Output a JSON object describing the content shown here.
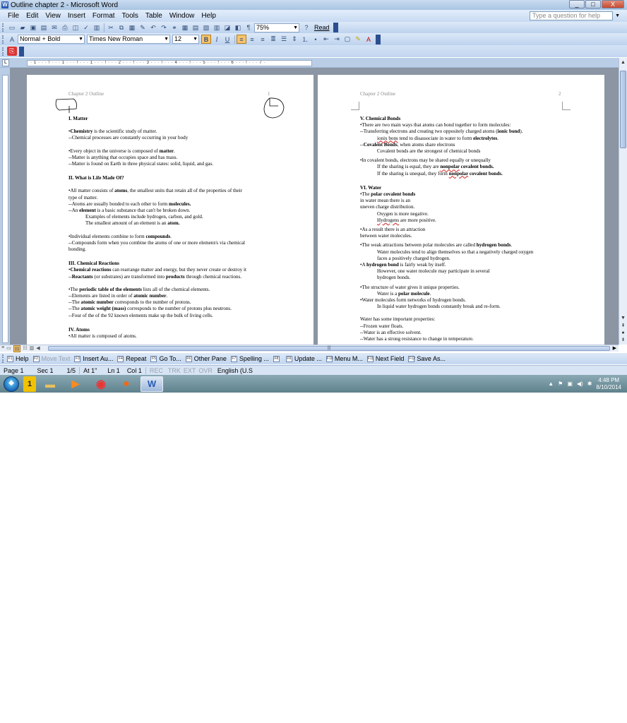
{
  "window": {
    "title": "Outline chapter 2 - Microsoft Word",
    "min": "_",
    "max": "□",
    "close": "X"
  },
  "menu": {
    "items": [
      "File",
      "Edit",
      "View",
      "Insert",
      "Format",
      "Tools",
      "Table",
      "Window",
      "Help"
    ],
    "help_placeholder": "Type a question for help"
  },
  "toolbar": {
    "zoom": "75%",
    "read": "Read",
    "style": "Normal + Bold",
    "font": "Times New Roman",
    "size": "12",
    "bold": "B",
    "italic": "I",
    "underline": "U"
  },
  "ruler": {
    "ticks": "· 1 · · · ! · · · 1 · · · ! · · · 1 · · · ! · · · 2 · · · ! · · · 3 · · · ! · · · 4 · · · ! · · · 5 · · · ! · · · 6 · · · ! · · · 7 ·"
  },
  "page1": {
    "header": "Chapter 2 Outline",
    "page_number": "1",
    "lines": [
      {
        "t": "I. Matter",
        "cls": "h"
      },
      {
        "t": "",
        "cls": "gap"
      },
      {
        "h": "•<b>Chemistry</b> is the scientific study of matter."
      },
      {
        "t": "--Chemical processes are constantly occurring in your body"
      },
      {
        "t": "",
        "cls": "gap"
      },
      {
        "h": "•Every object in the universe is composed of <b>matter</b>."
      },
      {
        "t": "--Matter is anything that occupies space and has mass."
      },
      {
        "t": "--Matter is found on Earth in three physical states: solid, liquid, and gas."
      },
      {
        "t": "",
        "cls": "gap"
      },
      {
        "t": "II. What is Life Made Of?",
        "cls": "h"
      },
      {
        "t": "",
        "cls": "gap"
      },
      {
        "h": "•All matter consists of <b>atoms</b>, the smallest units that retain all of the properties of their"
      },
      {
        "t": "type of matter."
      },
      {
        "h": "--Atoms are usually bonded to each other to form <b>molecules.</b>"
      },
      {
        "h": "--An <b>element</b> is a basic substance that can't be broken down."
      },
      {
        "t": "Examples of elements include hydrogen, carbon, and gold.",
        "cls": "ind"
      },
      {
        "h": "The smallest amount of an element is an <b>atom.</b>",
        "cls": "ind"
      },
      {
        "t": "",
        "cls": "gap"
      },
      {
        "h": "•Individual elements combine to form <b>compounds</b>."
      },
      {
        "t": "--Compounds form when you combine the atoms of one or more element/s via chemical"
      },
      {
        "t": "bonding."
      },
      {
        "t": "",
        "cls": "gap"
      },
      {
        "t": "III. Chemical Reactions",
        "cls": "h"
      },
      {
        "h": "•<b>Chemical reactions</b> can rearrange matter and energy, but they never create or destroy it"
      },
      {
        "h": "--<b>Reactants</b> (or substrates) are transformed into <b>products</b> through chemical reactions."
      },
      {
        "t": "",
        "cls": "gap"
      },
      {
        "h": "•The <b>periodic table of the elements</b> lists all of the chemical elements."
      },
      {
        "h": "--Elements are listed in order of <b>atomic number</b>."
      },
      {
        "h": "--The <b>atomic number</b> corresponds to the number of protons."
      },
      {
        "h": "--The <b>atomic weight (mass)</b> corresponds to the number of protons plus neutrons."
      },
      {
        "t": "--Four of the of the 92 known elements make up the bulk of living cells."
      },
      {
        "t": "",
        "cls": "gap"
      },
      {
        "t": "IV. Atoms",
        "cls": "h"
      },
      {
        "t": "•All matter is composed of atoms."
      }
    ]
  },
  "page2": {
    "header": "Chapter 2 Outline",
    "page_number": "2",
    "lines": [
      {
        "t": "V. Chemical Bonds",
        "cls": "h"
      },
      {
        "t": "•There are two main ways that atoms can bond together to form molecules:"
      },
      {
        "h": "--Transferring electrons and creating two oppositely charged atoms (<b>ionic bond</b>)."
      },
      {
        "h": "<span class='red'>ionix bons</span> tend to disassociate in water to form <b>electrolytes</b>.",
        "cls": "ind"
      },
      {
        "h": "--<b>Covalent Bonds</b>, when atoms share electrons"
      },
      {
        "t": "Covalent bonds are the strongest of chemical bonds",
        "cls": "ind"
      },
      {
        "t": "",
        "cls": "gap-s"
      },
      {
        "t": "•In covalent bonds, electrons may be shared equally or unequally"
      },
      {
        "h": "If the sharing is equal, they are <b><span class='red'>nonpolar</span> covalent bonds.</b>",
        "cls": "ind"
      },
      {
        "h": "If the sharing is unequal, they form <b><span class='red'>nonpolar</span> covalent bonds.</b>",
        "cls": "ind"
      },
      {
        "t": "",
        "cls": "gap"
      },
      {
        "t": "VI. Water",
        "cls": "h"
      },
      {
        "h": "•The <b>polar covalent bonds</b>"
      },
      {
        "t": "in water mean there is an"
      },
      {
        "t": "uneven charge distribution."
      },
      {
        "t": "Oxygen is more negative.",
        "cls": "ind"
      },
      {
        "h": "<span class='red'>Hydrogens</span> are more positive.",
        "cls": "ind"
      },
      {
        "t": "",
        "cls": "gap-s"
      },
      {
        "t": "•As a result there is an attraction"
      },
      {
        "t": "between water molecules."
      },
      {
        "t": "",
        "cls": "gap-s"
      },
      {
        "h": "•The weak attractions between polar molecules are called <b>hydrogen bonds</b>."
      },
      {
        "t": "Water molecules tend to align themselves so that a negatively charged oxygen",
        "cls": "ind"
      },
      {
        "t": "faces a positively charged hydrogen.",
        "cls": "ind"
      },
      {
        "h": "•A <b>hydrogen bond</b> is fairly weak by itself.",
        "cls": ""
      },
      {
        "t": "However, one water molecule may participate in several",
        "cls": "ind"
      },
      {
        "t": "hydrogen bonds.",
        "cls": "ind"
      },
      {
        "t": "",
        "cls": "gap-s"
      },
      {
        "t": "•The structure of water gives it unique properties."
      },
      {
        "h": "Water is a <b>polar molecule</b>.",
        "cls": "ind"
      },
      {
        "t": "•Water molecules form networks of hydrogen bonds."
      },
      {
        "t": "In liquid water hydrogen bonds constantly break and re-form.",
        "cls": "ind"
      },
      {
        "t": "",
        "cls": "gap"
      },
      {
        "t": "Water has some important properties:"
      },
      {
        "t": "--Frozen water floats."
      },
      {
        "t": "--Water is an effective solvent."
      },
      {
        "t": "--Water has a strong resistance to change in temperature."
      }
    ]
  },
  "fkeys": [
    {
      "k": "F1",
      "label": "Help",
      "dis": false
    },
    {
      "k": "F2",
      "label": "Move Text",
      "dis": true
    },
    {
      "k": "F3",
      "label": "Insert Au...",
      "dis": false
    },
    {
      "k": "F4",
      "label": "Repeat",
      "dis": false
    },
    {
      "k": "F5",
      "label": "Go To...",
      "dis": false
    },
    {
      "k": "F6",
      "label": "Other Pane",
      "dis": false
    },
    {
      "k": "F7",
      "label": "Spelling ...",
      "dis": false
    },
    {
      "k": "F8",
      "label": "",
      "dis": false
    },
    {
      "k": "F9",
      "label": "Update ...",
      "dis": false
    },
    {
      "k": "F10",
      "label": "Menu M...",
      "dis": false
    },
    {
      "k": "F11",
      "label": "Next Field",
      "dis": false
    },
    {
      "k": "F12",
      "label": "Save As...",
      "dis": false
    }
  ],
  "status": {
    "page": "Page 1",
    "sec": "Sec 1",
    "pages": "1/5",
    "at": "At 1\"",
    "ln": "Ln 1",
    "col": "Col 1",
    "rec": "REC",
    "trk": "TRK",
    "ext": "EXT",
    "ovr": "OVR",
    "lang": "English (U.S"
  },
  "taskbar": {
    "time": "4:48 PM",
    "date": "8/10/2014"
  }
}
